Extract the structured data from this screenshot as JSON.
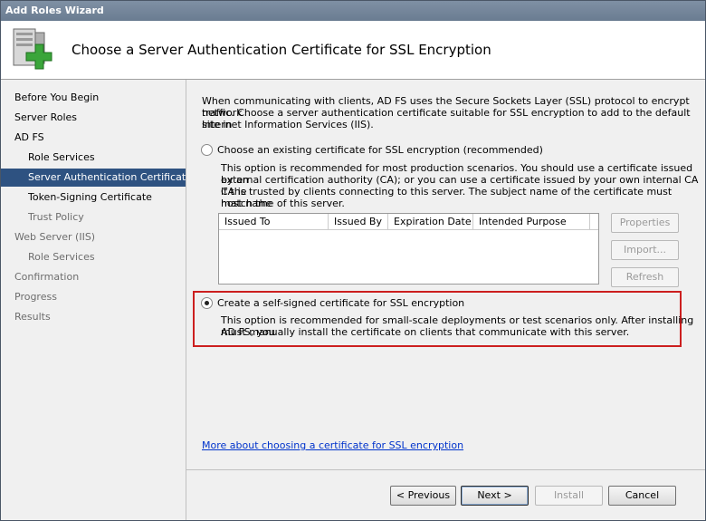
{
  "window": {
    "title": "Add Roles Wizard"
  },
  "header": {
    "title": "Choose a Server Authentication Certificate for SSL Encryption"
  },
  "nav": {
    "items": [
      {
        "label": "Before You Begin",
        "level": "top",
        "state": "normal"
      },
      {
        "label": "Server Roles",
        "level": "top",
        "state": "normal"
      },
      {
        "label": "AD FS",
        "level": "top",
        "state": "normal"
      },
      {
        "label": "Role Services",
        "level": "indent",
        "state": "normal"
      },
      {
        "label": "Server Authentication Certificate",
        "level": "indent",
        "state": "selected"
      },
      {
        "label": "Token-Signing Certificate",
        "level": "indent",
        "state": "normal"
      },
      {
        "label": "Trust Policy",
        "level": "indent",
        "state": "disabled"
      },
      {
        "label": "Web Server (IIS)",
        "level": "top",
        "state": "disabled"
      },
      {
        "label": "Role Services",
        "level": "indent",
        "state": "disabled"
      },
      {
        "label": "Confirmation",
        "level": "top",
        "state": "disabled"
      },
      {
        "label": "Progress",
        "level": "top",
        "state": "disabled"
      },
      {
        "label": "Results",
        "level": "top",
        "state": "disabled"
      }
    ]
  },
  "main": {
    "intro": [
      "When communicating with clients, AD FS uses the Secure Sockets Layer (SSL) protocol to encrypt network",
      "traffic. Choose a server authentication certificate suitable for SSL encryption to add to the default site in",
      "Internet Information Services (IIS)."
    ],
    "option1": {
      "label": "Choose an existing certificate for SSL encryption (recommended)",
      "checked": false,
      "desc": [
        "This option is recommended for most production scenarios. You should use a certificate issued by an",
        "external certification authority (CA); or you can use a certificate issued by your own internal CA if the",
        "CA is trusted by clients connecting to this server. The subject name of the certificate must match the",
        "host name of this server."
      ]
    },
    "cert_table": {
      "columns": [
        "Issued To",
        "Issued By",
        "Expiration Date",
        "Intended Purpose"
      ],
      "rows": []
    },
    "side_buttons": {
      "properties": "Properties",
      "import": "Import...",
      "refresh": "Refresh"
    },
    "option2": {
      "label": "Create a self-signed certificate for SSL encryption",
      "checked": true,
      "desc": [
        "This option is recommended for small-scale deployments or test scenarios only. After installing AD FS, you",
        "must manually install the certificate on clients that communicate with this server."
      ]
    },
    "link": "More about choosing a certificate for SSL encryption"
  },
  "footer": {
    "previous": "< Previous",
    "next": "Next >",
    "install": "Install",
    "cancel": "Cancel"
  },
  "colors": {
    "selection": "#2e5281",
    "highlight_box": "#cc1f1f",
    "link": "#0033cc"
  }
}
